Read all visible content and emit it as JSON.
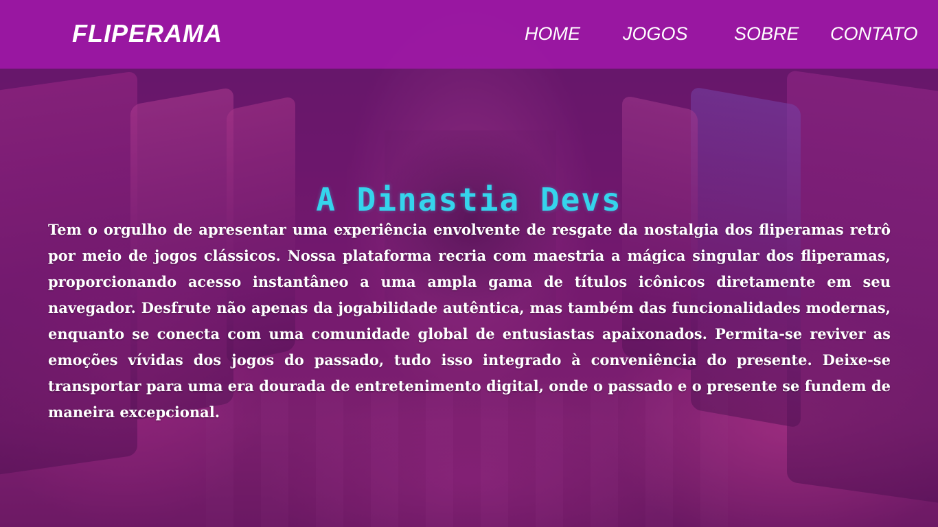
{
  "navbar": {
    "brand": "FLIPERAMA",
    "links": [
      {
        "label": "HOME"
      },
      {
        "label": "JOGOS"
      },
      {
        "label": "SOBRE"
      },
      {
        "label": "CONTATO"
      }
    ],
    "background_color": "#a018a8"
  },
  "hero": {
    "title": "A Dinastia Devs",
    "title_color": "#35d4ec",
    "description": "Tem o orgulho de apresentar uma experiência envolvente de resgate da nostalgia dos fliperamas retrô por meio de jogos clássicos. Nossa plataforma recria com maestria a mágica singular dos fliperamas, proporcionando acesso instantâneo a uma ampla gama de títulos icônicos diretamente em seu navegador. Desfrute não apenas da jogabilidade autêntica, mas também das funcionalidades modernas, enquanto se conecta com uma comunidade global de entusiastas apaixonados. Permita-se reviver as emoções vívidas dos jogos do passado, tudo isso integrado à conveniência do presente. Deixe-se transportar para uma era dourada de entretenimento digital, onde o passado e o presente se fundem de maneira excepcional."
  }
}
